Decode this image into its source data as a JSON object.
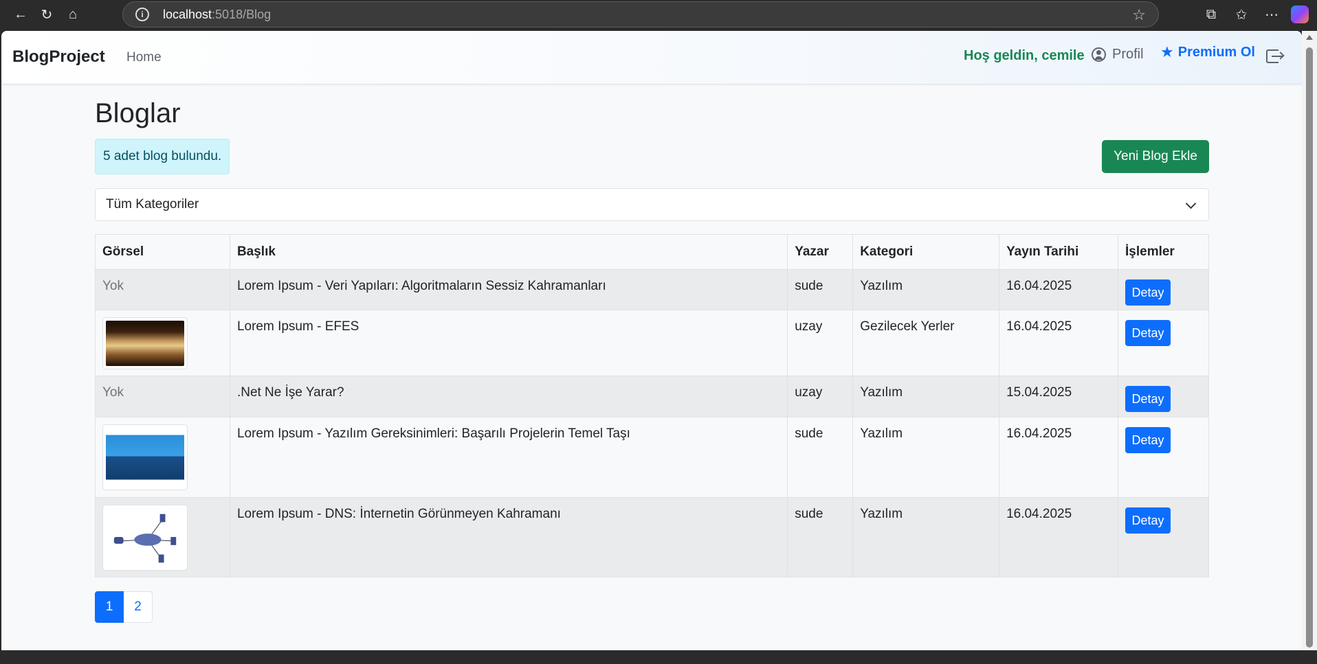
{
  "browser": {
    "url_host": "localhost",
    "url_rest": ":5018/Blog"
  },
  "navbar": {
    "brand": "BlogProject",
    "home": "Home",
    "welcome": "Hoş geldin, cemile",
    "profile": "Profil",
    "premium": "Premium Ol"
  },
  "page": {
    "title": "Bloglar",
    "count_text": "5 adet blog bulundu.",
    "new_blog_button": "Yeni Blog Ekle",
    "category_select": "Tüm Kategoriler"
  },
  "table": {
    "headers": [
      "Görsel",
      "Başlık",
      "Yazar",
      "Kategori",
      "Yayın Tarihi",
      "İşlemler"
    ],
    "rows": [
      {
        "image": "Yok",
        "title": "Lorem Ipsum - Veri Yapıları: Algoritmaların Sessiz Kahramanları",
        "author": "sude",
        "category": "Yazılım",
        "date": "16.04.2025",
        "action": "Detay"
      },
      {
        "image": "",
        "title": "Lorem Ipsum - EFES",
        "author": "uzay",
        "category": "Gezilecek Yerler",
        "date": "16.04.2025",
        "action": "Detay"
      },
      {
        "image": "Yok",
        "title": ".Net Ne İşe Yarar?",
        "author": "uzay",
        "category": "Yazılım",
        "date": "15.04.2025",
        "action": "Detay"
      },
      {
        "image": "",
        "title": "Lorem Ipsum - Yazılım Gereksinimleri: Başarılı Projelerin Temel Taşı",
        "author": "sude",
        "category": "Yazılım",
        "date": "16.04.2025",
        "action": "Detay"
      },
      {
        "image": "",
        "title": "Lorem Ipsum - DNS: İnternetin Görünmeyen Kahramanı",
        "author": "sude",
        "category": "Yazılım",
        "date": "16.04.2025",
        "action": "Detay"
      }
    ]
  },
  "pagination": [
    "1",
    "2"
  ],
  "icons": {
    "back": "arrow-left-icon",
    "refresh": "refresh-icon",
    "home": "home-icon",
    "info": "info-icon",
    "favorite": "star-outline-icon",
    "extensions": "puzzle-icon",
    "favorites_list": "favorites-icon",
    "more": "more-icon",
    "copilot": "copilot-icon",
    "user": "user-circle-icon",
    "premium_star": "star-icon",
    "logout": "logout-icon",
    "dropdown": "chevron-down-icon"
  },
  "colors": {
    "primary": "#0d6efd",
    "success": "#198754",
    "info_bg": "#cff4fc",
    "info_text": "#055160"
  }
}
